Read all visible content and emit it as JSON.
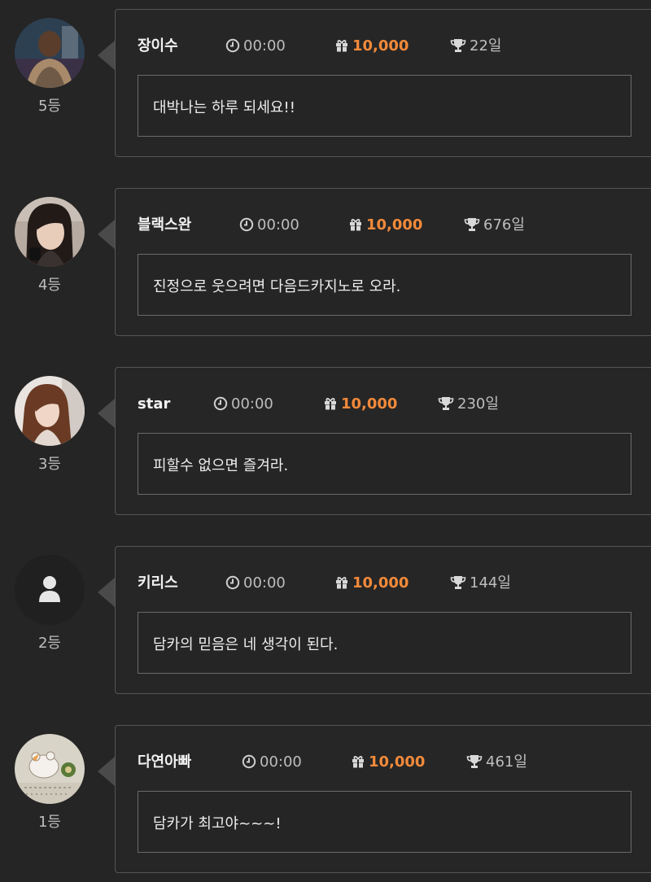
{
  "entries": [
    {
      "name": "장이수",
      "time": "00:00",
      "gift": "10,000",
      "days": "22일",
      "message": "대박나는 하루 되세요!!",
      "rank": "5등",
      "avatar": "photo-man"
    },
    {
      "name": "블랙스완",
      "time": "00:00",
      "gift": "10,000",
      "days": "676일",
      "message": "진정으로 웃으려면 다음드카지노로 오라.",
      "rank": "4등",
      "avatar": "photo-woman-dark-hair"
    },
    {
      "name": "star",
      "time": "00:00",
      "gift": "10,000",
      "days": "230일",
      "message": "피할수 없으면 즐겨라.",
      "rank": "3등",
      "avatar": "photo-woman-brown-hair"
    },
    {
      "name": "키리스",
      "time": "00:00",
      "gift": "10,000",
      "days": "144일",
      "message": "담카의 믿음은 네 생각이 된다.",
      "rank": "2등",
      "avatar": "default-user-icon"
    },
    {
      "name": "다연아빠",
      "time": "00:00",
      "gift": "10,000",
      "days": "461일",
      "message": "담카가 최고야~~~!",
      "rank": "1등",
      "avatar": "photo-hamster-drawing"
    }
  ],
  "colors": {
    "background": "#252525",
    "card_border": "#555555",
    "gift_accent": "#f28a3a",
    "muted_text": "#bdbdbd"
  },
  "icons": {
    "time": "clock-icon",
    "gift": "gift-icon",
    "days": "trophy-icon"
  }
}
